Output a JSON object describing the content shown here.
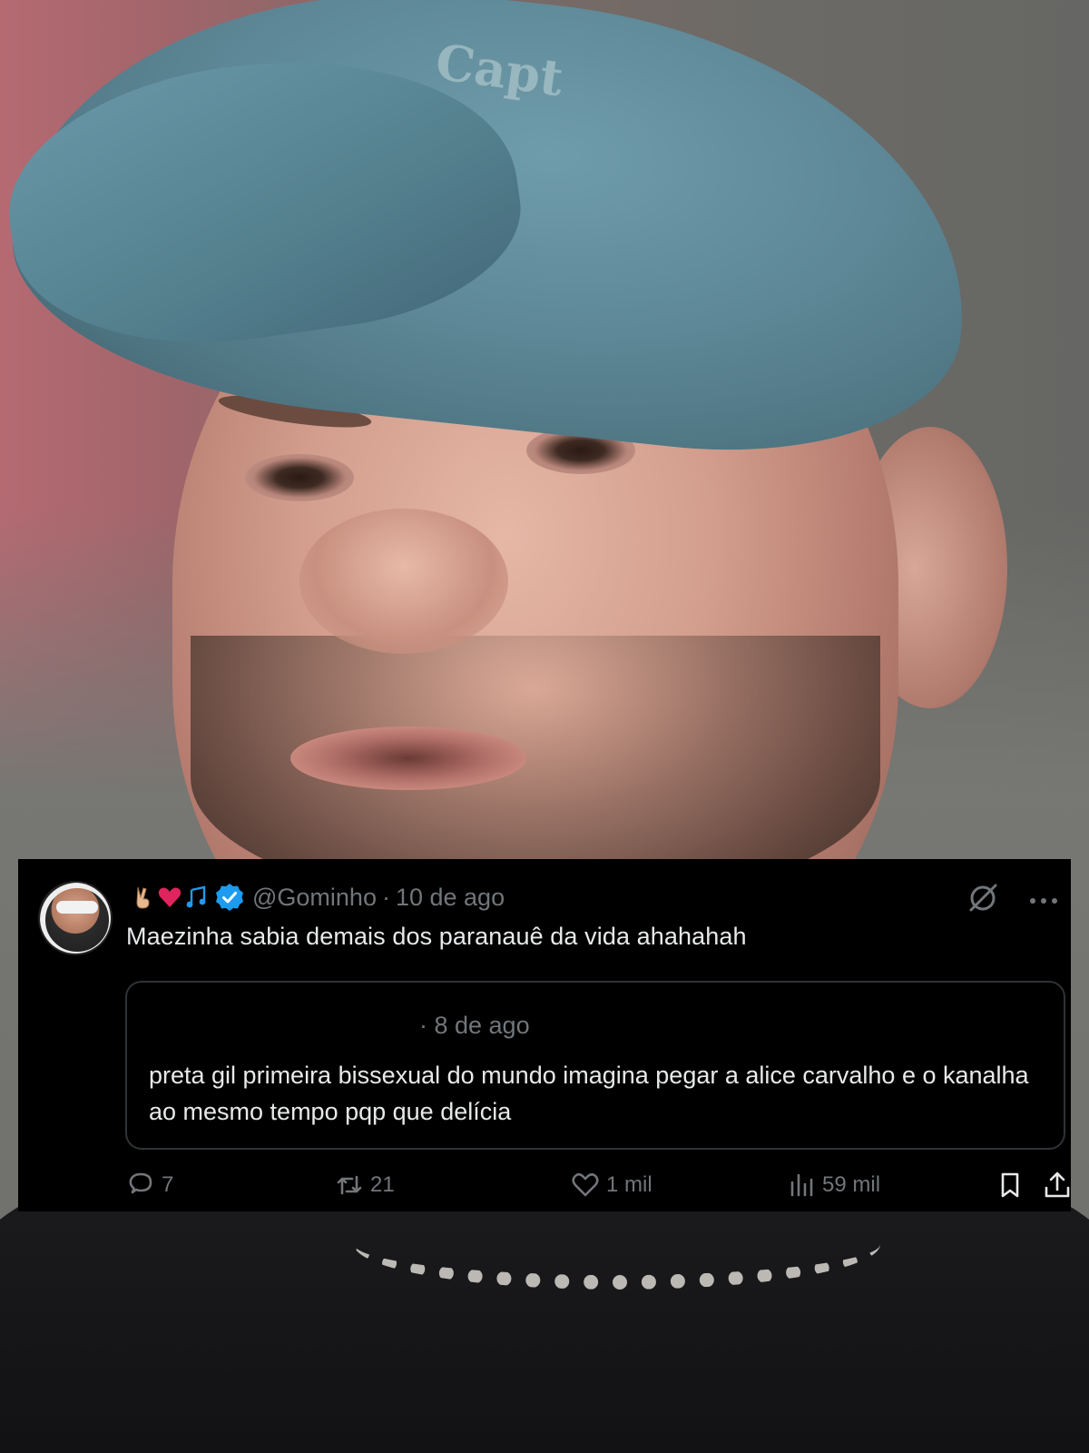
{
  "tweet": {
    "emojis": [
      "victory-hand-icon",
      "red-heart-icon",
      "music-notes-icon"
    ],
    "handle": "@Gominho",
    "separator": "·",
    "time": "10 de ago",
    "text": "Maezinha sabia demais dos paranauê da vida ahahahah",
    "quoted": {
      "time": "· 8 de ago",
      "text": "preta gil primeira bissexual do mundo imagina pegar a alice carvalho e o kanalha ao mesmo tempo pqp que delícia"
    },
    "actions": {
      "replies": "7",
      "retweets": "21",
      "likes": "1 mil",
      "views": "59 mil"
    }
  },
  "photo": {
    "cap_text": "Capt"
  },
  "colors": {
    "card_background": "#000000",
    "text_primary": "#e7e9ea",
    "text_secondary": "#71767b",
    "verified_blue": "#1d9bf0",
    "quote_border": "#2f3336"
  }
}
